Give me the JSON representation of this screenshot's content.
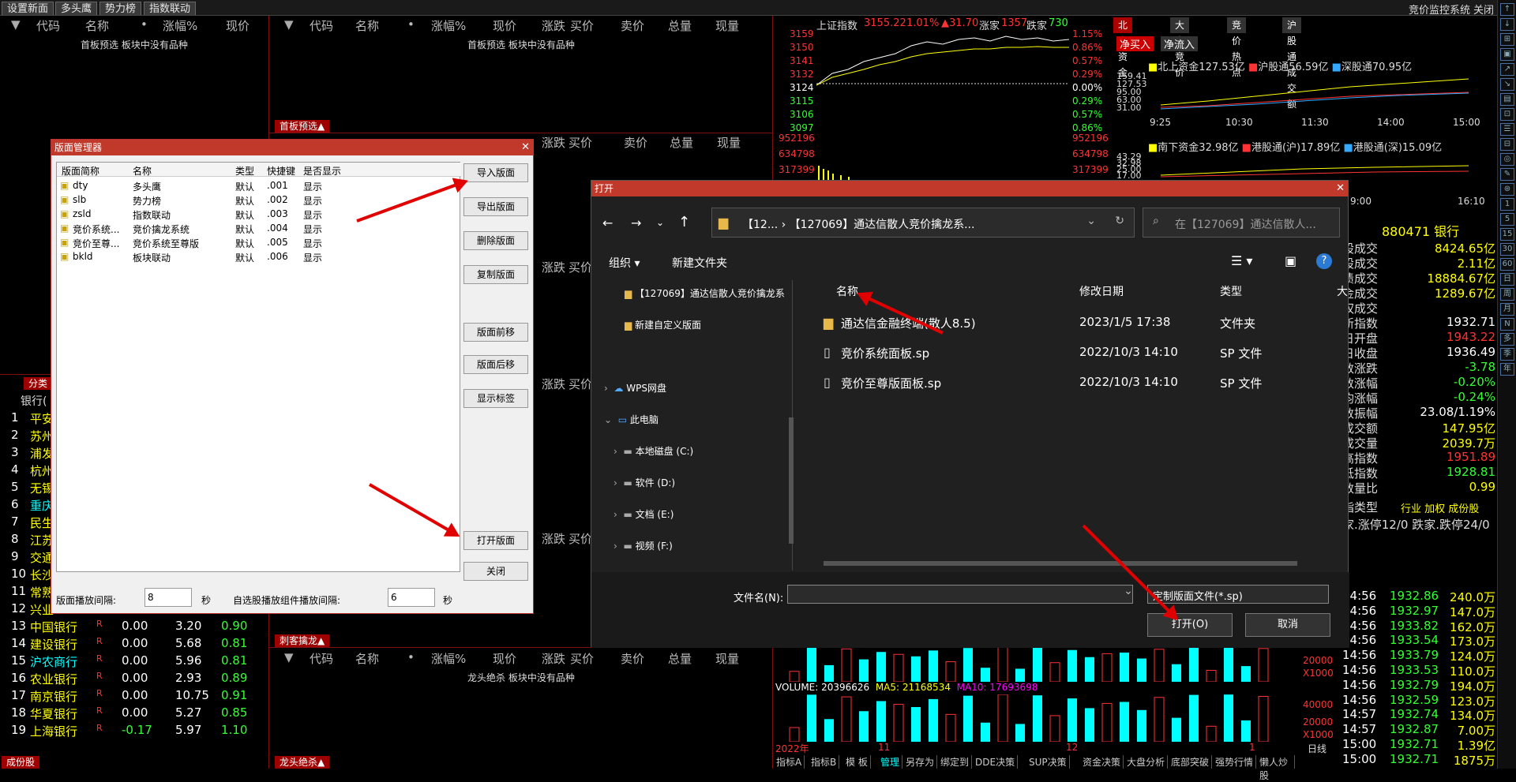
{
  "topbar": {
    "tabs": [
      "设置新面",
      "多头鹰",
      "势力榜",
      "指数联动"
    ],
    "right": [
      "竞价监控系统",
      "关闭"
    ]
  },
  "panel_headers": {
    "left": [
      "代码",
      "名称",
      "•",
      "涨幅%",
      "现价"
    ],
    "middle": [
      "代码",
      "名称",
      "•",
      "涨幅%",
      "现价",
      "涨跌",
      "买价",
      "卖价",
      "总量",
      "现量"
    ],
    "empty_text": "首板预选 板块中没有品种",
    "empty_text_2": "龙头绝杀 板块中没有品种"
  },
  "red_tabs": [
    "首板预选▲",
    "刺客擒龙▲",
    "龙头绝杀▲",
    "成份股",
    "分类"
  ],
  "index": {
    "name": "上证指数",
    "value": "3155.22",
    "change_pct": "1.01%",
    "change": "▲31.70",
    "up_label": "涨家",
    "up_count": "1357",
    "down_label": "跌家",
    "down_count": "730",
    "y_ticks_left": [
      "3159",
      "3150",
      "3141",
      "3132",
      "3124",
      "3115",
      "3106",
      "3097"
    ],
    "y_ticks_right": [
      "1.15%",
      "0.86%",
      "0.57%",
      "0.29%",
      "0.00%",
      "0.29%",
      "0.57%",
      "0.86%"
    ],
    "vol_ticks": [
      "952196",
      "634798",
      "317399"
    ]
  },
  "north_tabs": [
    "北向资金",
    "大盘竞价",
    "竞价热点",
    "沪股通成交额"
  ],
  "north": {
    "btn1": "净买入",
    "btn2": "净流入",
    "legend": [
      "北上资金127.53亿",
      "沪股通56.59亿",
      "深股通70.95亿"
    ],
    "y_ticks": [
      "159.41",
      "127.53",
      "95.00",
      "63.00",
      "31.00"
    ],
    "x_ticks": [
      "9:25",
      "10:30",
      "11:30",
      "14:00",
      "15:00"
    ],
    "legend2": [
      "南下资金32.98亿",
      "港股通(沪)17.89亿",
      "港股通(深)15.09亿"
    ],
    "y_ticks2": [
      "43.29",
      "32.98",
      "25.00",
      "17.00"
    ],
    "x_ticks2": [
      "9:00",
      "16:10"
    ]
  },
  "sector": {
    "title": "880471 银行",
    "rows": [
      {
        "label": "股成交",
        "value": "8424.65亿",
        "color": "#ff0"
      },
      {
        "label": "股成交",
        "value": "2.11亿",
        "color": "#ff0"
      },
      {
        "label": "债成交",
        "value": "18884.67亿",
        "color": "#ff0"
      },
      {
        "label": "金成交",
        "value": "1289.67亿",
        "color": "#ff0"
      },
      {
        "label": "权成交",
        "value": "",
        "color": "#ff0"
      },
      {
        "label": "新指数",
        "value": "1932.71",
        "color": "#fff"
      },
      {
        "label": "日开盘",
        "value": "1943.22",
        "color": "#f33"
      },
      {
        "label": "日收盘",
        "value": "1936.49",
        "color": "#fff"
      },
      {
        "label": "数涨跌",
        "value": "-3.78",
        "color": "#3f3"
      },
      {
        "label": "数涨幅",
        "value": "-0.20%",
        "color": "#3f3"
      },
      {
        "label": "均涨幅",
        "value": "-0.24%",
        "color": "#3f3"
      },
      {
        "label": "数振幅",
        "value": "23.08/1.19%",
        "color": "#fff"
      },
      {
        "label": "成交额",
        "value": "147.95亿",
        "color": "#ff0"
      },
      {
        "label": "成交量",
        "value": "2039.7万",
        "color": "#ff0"
      },
      {
        "label": "高指数",
        "value": "1951.89",
        "color": "#f33"
      },
      {
        "label": "低指数",
        "value": "1928.81",
        "color": "#3f3"
      },
      {
        "label": "数量比",
        "value": "0.99",
        "color": "#ff0"
      }
    ],
    "type_label": "指类型",
    "type_value": "行业 加权 成份股",
    "updown": "家.涨停12/0 跌家.跌停24/0"
  },
  "ticks": [
    {
      "t": "14:56",
      "p": "1932.86",
      "v": "240.0万"
    },
    {
      "t": "14:56",
      "p": "1932.97",
      "v": "147.0万"
    },
    {
      "t": "14:56",
      "p": "1933.82",
      "v": "162.0万"
    },
    {
      "t": "14:56",
      "p": "1933.54",
      "v": "173.0万"
    },
    {
      "t": "14:56",
      "p": "1933.79",
      "v": "124.0万"
    },
    {
      "t": "14:56",
      "p": "1933.53",
      "v": "110.0万"
    },
    {
      "t": "14:56",
      "p": "1932.79",
      "v": "194.0万"
    },
    {
      "t": "14:56",
      "p": "1932.59",
      "v": "123.0万"
    },
    {
      "t": "14:57",
      "p": "1932.74",
      "v": "134.0万"
    },
    {
      "t": "14:57",
      "p": "1932.87",
      "v": "7.00万"
    },
    {
      "t": "15:00",
      "p": "1932.71",
      "v": "1.39亿"
    },
    {
      "t": "15:00",
      "p": "1932.71",
      "v": "1875万"
    }
  ],
  "stocks_header": "银行(",
  "stocks": [
    {
      "n": "1",
      "name": "平安",
      "r": "",
      "chg": "",
      "p": "",
      "pct": ""
    },
    {
      "n": "2",
      "name": "苏州",
      "r": "",
      "chg": "",
      "p": "",
      "pct": ""
    },
    {
      "n": "3",
      "name": "浦发",
      "r": "",
      "chg": "",
      "p": "",
      "pct": ""
    },
    {
      "n": "4",
      "name": "杭州",
      "r": "",
      "chg": "",
      "p": "",
      "pct": ""
    },
    {
      "n": "5",
      "name": "无锡",
      "r": "",
      "chg": "",
      "p": "",
      "pct": ""
    },
    {
      "n": "6",
      "name": "重庆",
      "r": "",
      "chg": "",
      "p": "",
      "pct": ""
    },
    {
      "n": "7",
      "name": "民生",
      "r": "",
      "chg": "",
      "p": "",
      "pct": ""
    },
    {
      "n": "8",
      "name": "江苏",
      "r": "",
      "chg": "",
      "p": "",
      "pct": ""
    },
    {
      "n": "9",
      "name": "交通",
      "r": "",
      "chg": "",
      "p": "",
      "pct": ""
    },
    {
      "n": "10",
      "name": "长沙",
      "r": "",
      "chg": "",
      "p": "",
      "pct": ""
    },
    {
      "n": "11",
      "name": "常熟",
      "r": "",
      "chg": "",
      "p": "",
      "pct": ""
    },
    {
      "n": "12",
      "name": "兴业",
      "r": "",
      "chg": "",
      "p": "",
      "pct": ""
    },
    {
      "n": "13",
      "name": "中国银行",
      "r": "R",
      "chg": "0.00",
      "p": "3.20",
      "pct": "0.90"
    },
    {
      "n": "14",
      "name": "建设银行",
      "r": "R",
      "chg": "0.00",
      "p": "5.68",
      "pct": "0.81"
    },
    {
      "n": "15",
      "name": "沪农商行",
      "r": "R",
      "chg": "0.00",
      "p": "5.96",
      "pct": "0.81"
    },
    {
      "n": "16",
      "name": "农业银行",
      "r": "R",
      "chg": "0.00",
      "p": "2.93",
      "pct": "0.89"
    },
    {
      "n": "17",
      "name": "南京银行",
      "r": "R",
      "chg": "0.00",
      "p": "10.75",
      "pct": "0.91"
    },
    {
      "n": "18",
      "name": "华夏银行",
      "r": "R",
      "chg": "0.00",
      "p": "5.27",
      "pct": "0.85"
    },
    {
      "n": "19",
      "name": "上海银行",
      "r": "R",
      "chg": "-0.17",
      "p": "5.97",
      "pct": "1.10"
    }
  ],
  "kline": {
    "volume": "VOLUME: 20396626",
    "ma5": "MA5: 21168534",
    "ma10": "MA10: 17693698",
    "ticks": [
      "20000",
      "X1000",
      "40000",
      "20000",
      "X1000"
    ],
    "years": [
      "2022年",
      "11",
      "12",
      "1"
    ],
    "period": "日线"
  },
  "bottom_tabs": [
    "指标A",
    "指标B",
    "模 板",
    "管理",
    "另存为",
    "绑定到",
    "DDE决策",
    "SUP决策",
    "资金决策",
    "大盘分析",
    "底部突破",
    "强势行情",
    "懒人炒股"
  ],
  "layout_mgr": {
    "title": "版面管理器",
    "columns": [
      "版面简称",
      "名称",
      "类型",
      "快捷键",
      "是否显示"
    ],
    "rows": [
      {
        "abbr": "dty",
        "name": "多头鹰",
        "type": "默认",
        "key": ".001",
        "show": "显示"
      },
      {
        "abbr": "slb",
        "name": "势力榜",
        "type": "默认",
        "key": ".002",
        "show": "显示"
      },
      {
        "abbr": "zsld",
        "name": "指数联动",
        "type": "默认",
        "key": ".003",
        "show": "显示"
      },
      {
        "abbr": "竞价系统...",
        "name": "竞价擒龙系统",
        "type": "默认",
        "key": ".004",
        "show": "显示"
      },
      {
        "abbr": "竞价至尊...",
        "name": "竞价系统至尊版",
        "type": "默认",
        "key": ".005",
        "show": "显示"
      },
      {
        "abbr": "bkld",
        "name": "板块联动",
        "type": "默认",
        "key": ".006",
        "show": "显示"
      }
    ],
    "buttons": [
      "导入版面",
      "导出版面",
      "删除版面",
      "复制版面",
      "版面前移",
      "版面后移",
      "显示标签",
      "打开版面",
      "关闭"
    ],
    "interval_label": "版面播放间隔:",
    "interval_value": "8",
    "sec": "秒",
    "interval2_label": "自选股播放组件播放间隔:",
    "interval2_value": "6",
    "sec2": "秒"
  },
  "open_dlg": {
    "title": "打开",
    "path": "【12...  ›  【127069】通达信散人竞价擒龙系...",
    "search_placeholder": "在【127069】通达信散人...",
    "organize": "组织 ▾",
    "new_folder": "新建文件夹",
    "nav": [
      "【127069】通达信散人竞价擒龙系",
      "新建自定义版面",
      "WPS网盘",
      "此电脑",
      "本地磁盘 (C:)",
      "软件 (D:)",
      "文档 (E:)",
      "视频 (F:)"
    ],
    "col_name": "名称",
    "col_date": "修改日期",
    "col_type": "类型",
    "col_size": "大",
    "files": [
      {
        "name": "通达信金融终端(散人8.5)",
        "date": "2023/1/5 17:38",
        "type": "文件夹"
      },
      {
        "name": "竞价系统面板.sp",
        "date": "2022/10/3 14:10",
        "type": "SP 文件"
      },
      {
        "name": "竞价至尊版面板.sp",
        "date": "2022/10/3 14:10",
        "type": "SP 文件"
      }
    ],
    "filename_label": "文件名(N):",
    "filename_value": "",
    "filter": "定制版面文件(*.sp)",
    "open_btn": "打开(O)",
    "cancel_btn": "取消"
  },
  "rightbar_icons": [
    "↑",
    "↓",
    "⊞",
    "▣",
    "↗",
    "↘",
    "▤",
    "⊡",
    "☰",
    "⊟",
    "◎",
    "✎",
    "⊛",
    "1",
    "5",
    "15",
    "30",
    "60",
    "日",
    "周",
    "月",
    "N",
    "多",
    "季",
    "年"
  ]
}
